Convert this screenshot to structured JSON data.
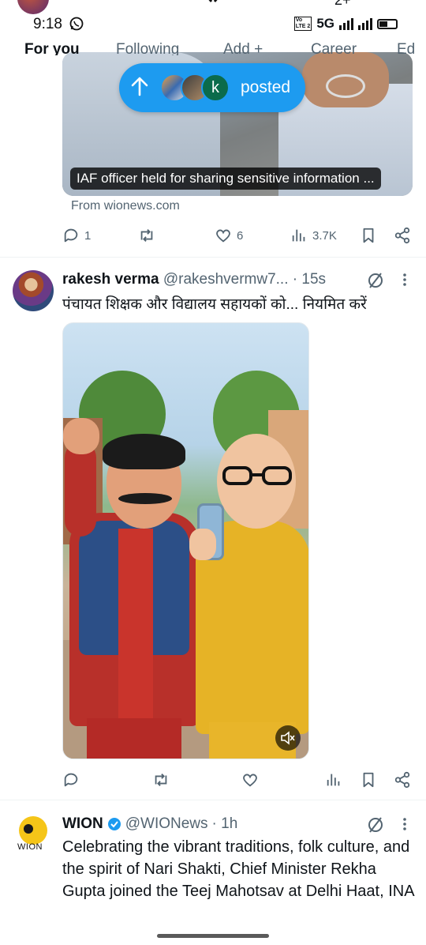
{
  "status_bar": {
    "time": "9:18",
    "network": "5G",
    "volte_top": "Vo",
    "volte_bottom": "LTE 2",
    "top_right_text": "2+"
  },
  "tabs": [
    {
      "label": "For you",
      "active": true
    },
    {
      "label": "Following",
      "active": false
    },
    {
      "label": "Add +",
      "active": false
    },
    {
      "label": "Career",
      "active": false
    },
    {
      "label": "Ed",
      "active": false
    }
  ],
  "posted_pill": {
    "avatar_letter": "k",
    "label": "posted"
  },
  "tweet1": {
    "media_caption": "IAF officer held for sharing sensitive information ...",
    "source": "From wionews.com",
    "replies": "1",
    "retweets": "",
    "likes": "6",
    "views": "3.7K"
  },
  "tweet2": {
    "name": "rakesh verma",
    "handle": "@rakeshvermw7...",
    "time": "· 15s",
    "text": "पंचायत शिक्षक और विद्यालय सहायकों को... नियमित करें",
    "replies": "",
    "retweets": "",
    "likes": "",
    "views": ""
  },
  "tweet3": {
    "name": "WION",
    "handle": "@WIONews",
    "time": "· 1h",
    "avatar_label": "WION",
    "text": "Celebrating the vibrant traditions, folk culture, and the spirit of Nari Shakti, Chief Minister Rekha Gupta joined the Teej Mahotsav at Delhi Haat, INA"
  },
  "colors": {
    "accent": "#1d9bf0",
    "text_primary": "#0f1419",
    "text_secondary": "#536471"
  },
  "icons": [
    "whatsapp-icon",
    "x-logo-icon",
    "arrow-up-icon",
    "reply-icon",
    "retweet-icon",
    "like-icon",
    "views-icon",
    "bookmark-icon",
    "share-icon",
    "grok-icon",
    "more-icon",
    "mute-icon",
    "verified-icon"
  ]
}
